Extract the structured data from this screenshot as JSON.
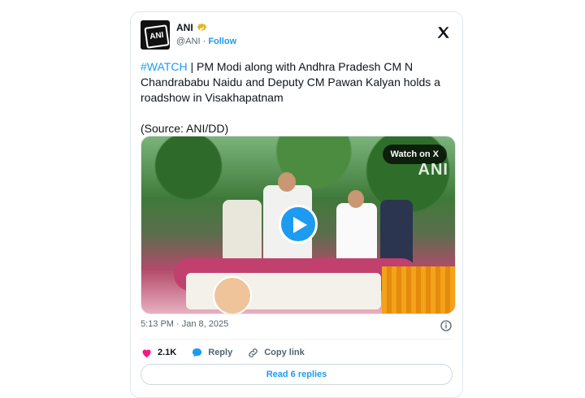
{
  "author": {
    "name": "ANI",
    "handle": "@ANI",
    "separator": "·",
    "follow_label": "Follow",
    "avatar_text": "ANI"
  },
  "tweet": {
    "hashtag": "#WATCH",
    "body": " | PM Modi along with Andhra Pradesh CM N Chandrababu Naidu and Deputy CM Pawan Kalyan holds a roadshow in Visakhapatnam\n\n(Source: ANI/DD)",
    "timestamp": "5:13 PM · Jan 8, 2025"
  },
  "media": {
    "watch_label": "Watch on X",
    "watermark": "ANI"
  },
  "actions": {
    "likes": "2.1K",
    "reply_label": "Reply",
    "copy_label": "Copy link"
  },
  "read_replies_label": "Read 6 replies",
  "colors": {
    "accent": "#1d9bf0",
    "like": "#f91880",
    "verified": "#e2b719"
  }
}
